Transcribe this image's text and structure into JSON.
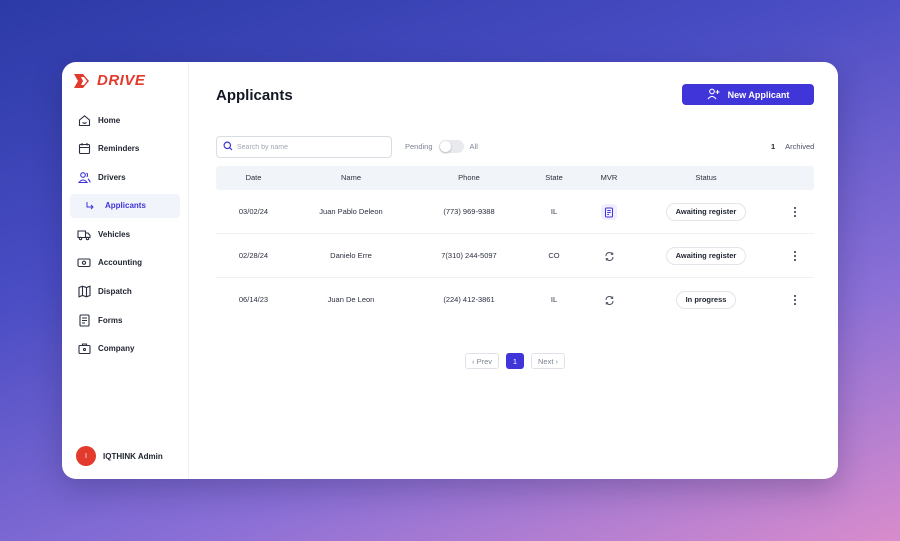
{
  "app": {
    "brand": "DRIVE",
    "brand_color": "#e23a2c",
    "accent": "#3f35d8"
  },
  "sidebar": {
    "items": [
      {
        "label": "Home",
        "icon": "home-icon"
      },
      {
        "label": "Reminders",
        "icon": "calendar-icon"
      },
      {
        "label": "Drivers",
        "icon": "users-icon"
      },
      {
        "label": "Applicants",
        "icon": "subitem-arrow-icon",
        "active": true
      },
      {
        "label": "Vehicles",
        "icon": "truck-icon"
      },
      {
        "label": "Accounting",
        "icon": "cash-icon"
      },
      {
        "label": "Dispatch",
        "icon": "map-icon"
      },
      {
        "label": "Forms",
        "icon": "form-icon"
      },
      {
        "label": "Company",
        "icon": "briefcase-icon"
      }
    ],
    "user": {
      "initial": "I",
      "name": "IQTHINK Admin"
    }
  },
  "header": {
    "title": "Applicants",
    "new_button": "New Applicant"
  },
  "filters": {
    "search_placeholder": "Search by name",
    "toggle_left": "Pending",
    "toggle_right": "All",
    "archived_count": "1",
    "archived_label": "Archived"
  },
  "table": {
    "columns": [
      "Date",
      "Name",
      "Phone",
      "State",
      "MVR",
      "Status"
    ],
    "rows": [
      {
        "date": "03/02/24",
        "name": "Juan Pablo Deleon",
        "phone": "(773) 969-9388",
        "state": "IL",
        "mvr": "document-icon",
        "status": "Awaiting register"
      },
      {
        "date": "02/28/24",
        "name": "Danielo Erre",
        "phone": "7(310) 244-5097",
        "state": "CO",
        "mvr": "refresh-icon",
        "status": "Awaiting register"
      },
      {
        "date": "06/14/23",
        "name": "Juan De Leon",
        "phone": "(224) 412-3861",
        "state": "IL",
        "mvr": "refresh-icon",
        "status": "In progress"
      }
    ]
  },
  "pagination": {
    "prev": "‹ Prev",
    "current": "1",
    "next": "Next ›"
  }
}
